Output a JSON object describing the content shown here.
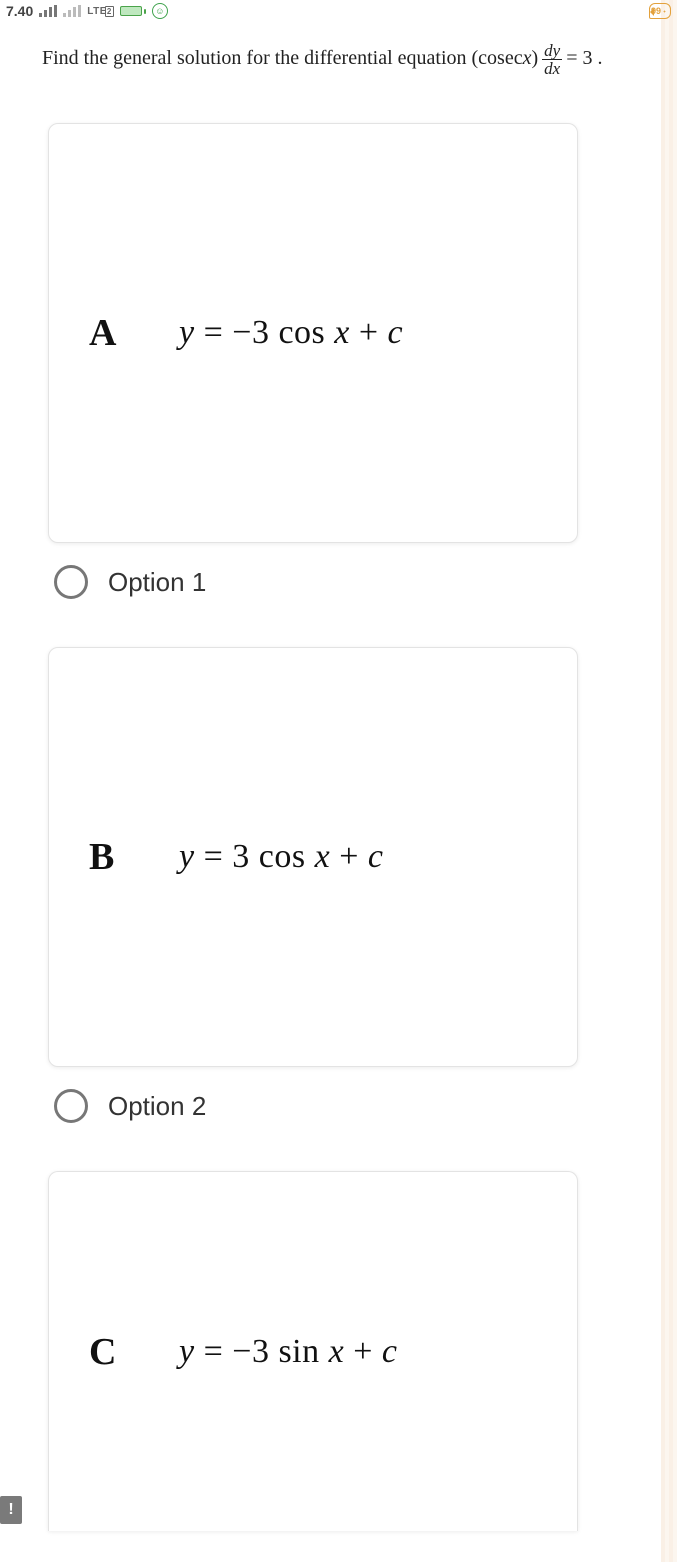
{
  "status": {
    "time": "7.40",
    "lte_label": "LTE",
    "lte_sub": "2",
    "chat_count": "99"
  },
  "question": {
    "prefix": "Find the general solution for the differential equation (cosec ",
    "var": "x",
    "close": ")",
    "frac_num": "dy",
    "frac_den": "dx",
    "suffix": " = 3 ."
  },
  "options": [
    {
      "letter": "A",
      "formula_html": "y = −3 cos x + c",
      "radio_label": "Option 1"
    },
    {
      "letter": "B",
      "formula_html": "y = 3 cos x + c",
      "radio_label": "Option 2"
    },
    {
      "letter": "C",
      "formula_html": "y = −3 sin x + c",
      "radio_label": ""
    }
  ],
  "alert": "!"
}
